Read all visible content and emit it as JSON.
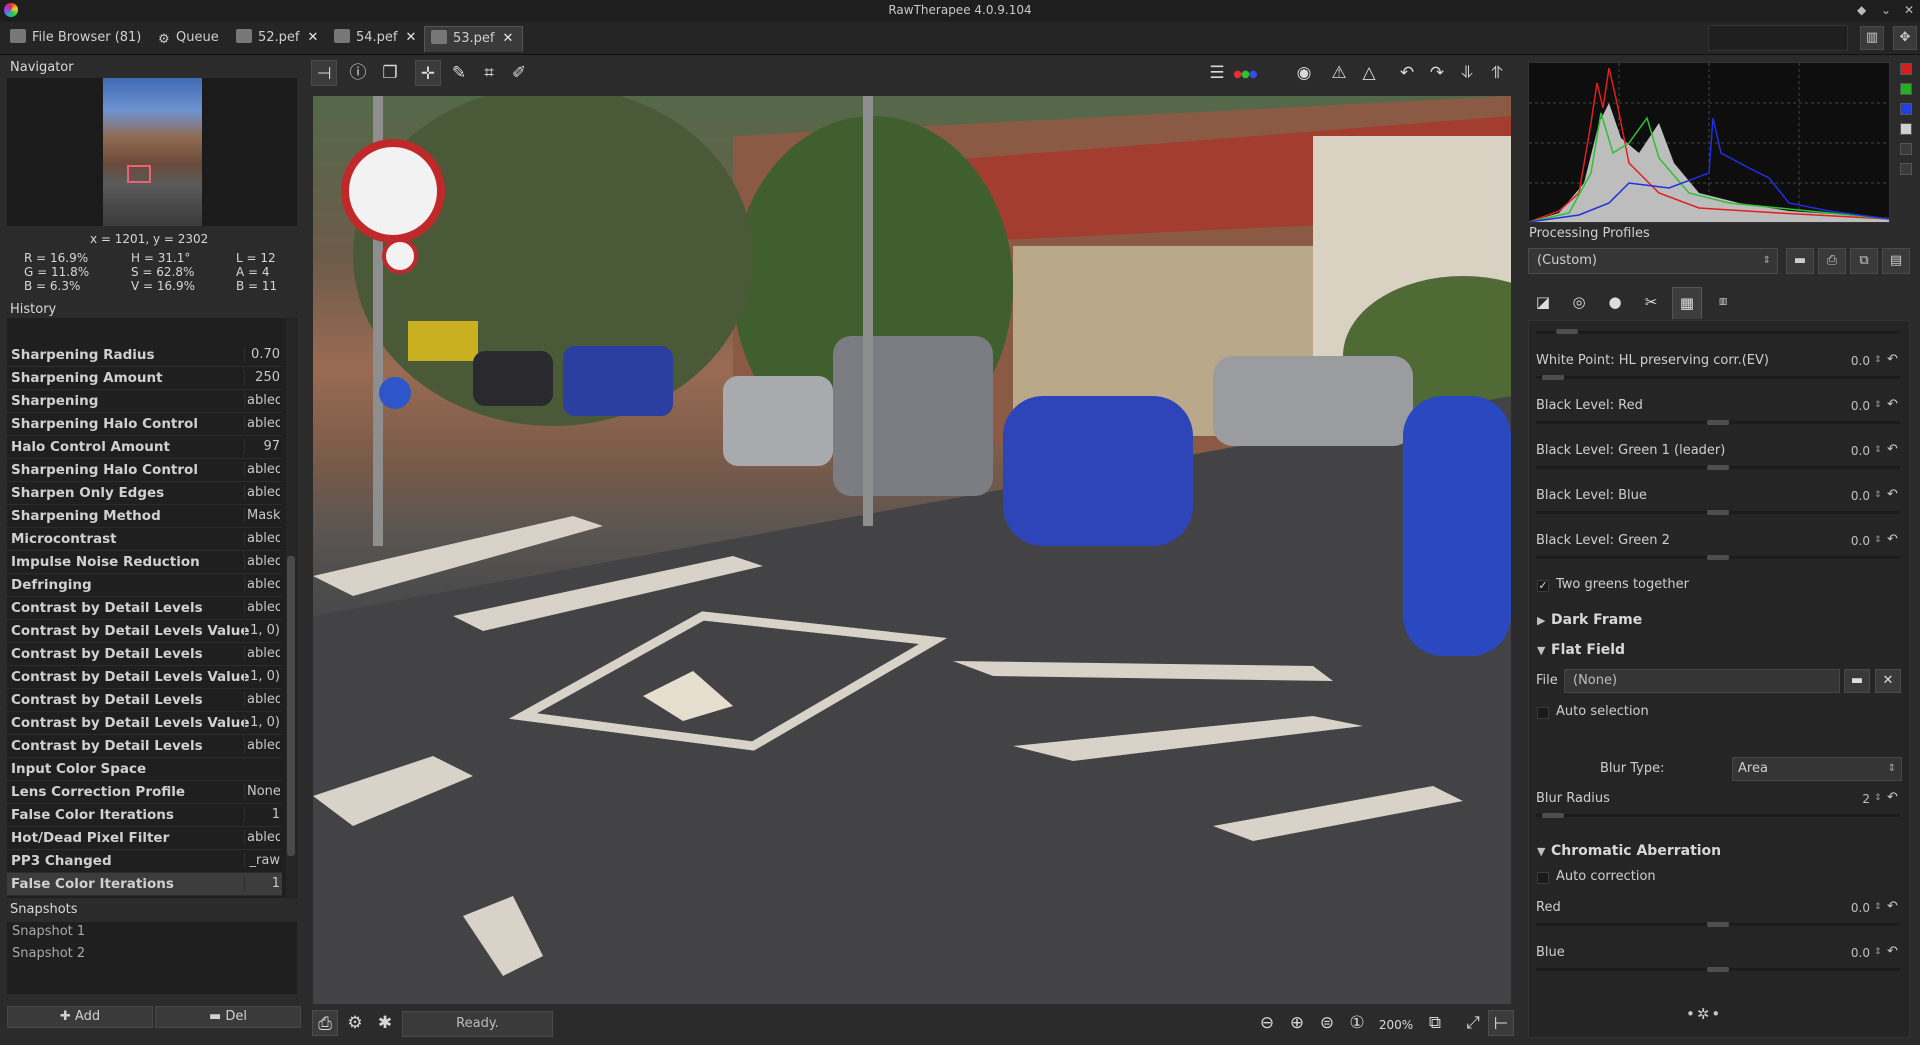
{
  "window": {
    "title": "RawTherapee 4.0.9.104"
  },
  "tabs": [
    {
      "label": "File Browser  (81)",
      "closable": false
    },
    {
      "label": "Queue",
      "closable": false
    },
    {
      "label": "52.pef",
      "closable": true
    },
    {
      "label": "54.pef",
      "closable": true
    },
    {
      "label": "53.pef",
      "closable": true,
      "active": true
    }
  ],
  "navigator": {
    "title": "Navigator",
    "coords": "x = 1201, y = 2302",
    "r": "R = 16.9%",
    "g": "G = 11.8%",
    "b": "B = 6.3%",
    "h": "H = 31.1°",
    "s": "S = 62.8%",
    "v": "V = 16.9%",
    "l": "L = 12",
    "a": "A = 4",
    "bb": "B = 11"
  },
  "history": {
    "title": "History",
    "rows": [
      {
        "name": "Sharpening Radius",
        "value": "0.70"
      },
      {
        "name": "Sharpening Amount",
        "value": "250"
      },
      {
        "name": "Sharpening",
        "value": "abled"
      },
      {
        "name": "Sharpening Halo Control",
        "value": "abled"
      },
      {
        "name": "Halo Control Amount",
        "value": "97"
      },
      {
        "name": "Sharpening Halo Control",
        "value": "abled"
      },
      {
        "name": "Sharpen Only Edges",
        "value": "abled"
      },
      {
        "name": "Sharpening Method",
        "value": "Mask"
      },
      {
        "name": "Microcontrast",
        "value": "abled"
      },
      {
        "name": "Impulse Noise Reduction",
        "value": "abled"
      },
      {
        "name": "Defringing",
        "value": "abled"
      },
      {
        "name": "Contrast by Detail Levels",
        "value": "abled"
      },
      {
        "name": "Contrast by Detail Levels Value",
        "value": "1, 0)"
      },
      {
        "name": "Contrast by Detail Levels",
        "value": "abled"
      },
      {
        "name": "Contrast by Detail Levels Value",
        "value": "1, 0)"
      },
      {
        "name": "Contrast by Detail Levels",
        "value": "abled"
      },
      {
        "name": "Contrast by Detail Levels Value",
        "value": "1, 0)"
      },
      {
        "name": "Contrast by Detail Levels",
        "value": "abled"
      },
      {
        "name": "Input Color Space",
        "value": ""
      },
      {
        "name": "Lens Correction Profile",
        "value": "None"
      },
      {
        "name": "False Color Iterations",
        "value": "1"
      },
      {
        "name": "Hot/Dead Pixel Filter",
        "value": "abled"
      },
      {
        "name": "PP3 Changed",
        "value": "_raw"
      },
      {
        "name": "False Color Iterations",
        "value": "1",
        "selected": true
      }
    ]
  },
  "snapshots": {
    "title": "Snapshots",
    "items": [
      "Snapshot 1",
      "Snapshot 2"
    ],
    "add_label": "Add",
    "del_label": "Del"
  },
  "status": {
    "text": "Ready.",
    "zoom": "200%"
  },
  "processing_profiles": {
    "label": "Processing Profiles",
    "value": "(Custom)"
  },
  "tools": {
    "params_top": [
      {
        "label": "White Point: HL preserving corr.(EV)",
        "value": "0.0",
        "level": 0.0
      },
      {
        "label": "Black Level: Red",
        "value": "0.0",
        "level": 0.5
      },
      {
        "label": "Black Level: Green 1 (leader)",
        "value": "0.0",
        "level": 0.5
      },
      {
        "label": "Black Level: Blue",
        "value": "0.0",
        "level": 0.5
      },
      {
        "label": "Black Level: Green 2",
        "value": "0.0",
        "level": 0.5
      }
    ],
    "two_greens": {
      "label": "Two greens together",
      "checked": true
    },
    "dark_frame": {
      "title": "Dark Frame",
      "expanded": false
    },
    "flat_field": {
      "title": "Flat Field",
      "expanded": true,
      "file_label": "File",
      "file_value": "(None)",
      "auto_selection": "Auto selection",
      "blur_type_label": "Blur Type:",
      "blur_type_value": "Area",
      "blur_radius_label": "Blur Radius",
      "blur_radius_value": "2"
    },
    "chromatic_aberration": {
      "title": "Chromatic Aberration",
      "expanded": true,
      "auto_correction": "Auto correction",
      "red_label": "Red",
      "red_value": "0.0",
      "blue_label": "Blue",
      "blue_value": "0.0"
    }
  },
  "colors": {
    "accent_red": "#f06070",
    "hist_red": "#e02020",
    "hist_green": "#30c030",
    "hist_blue": "#2030e0"
  }
}
